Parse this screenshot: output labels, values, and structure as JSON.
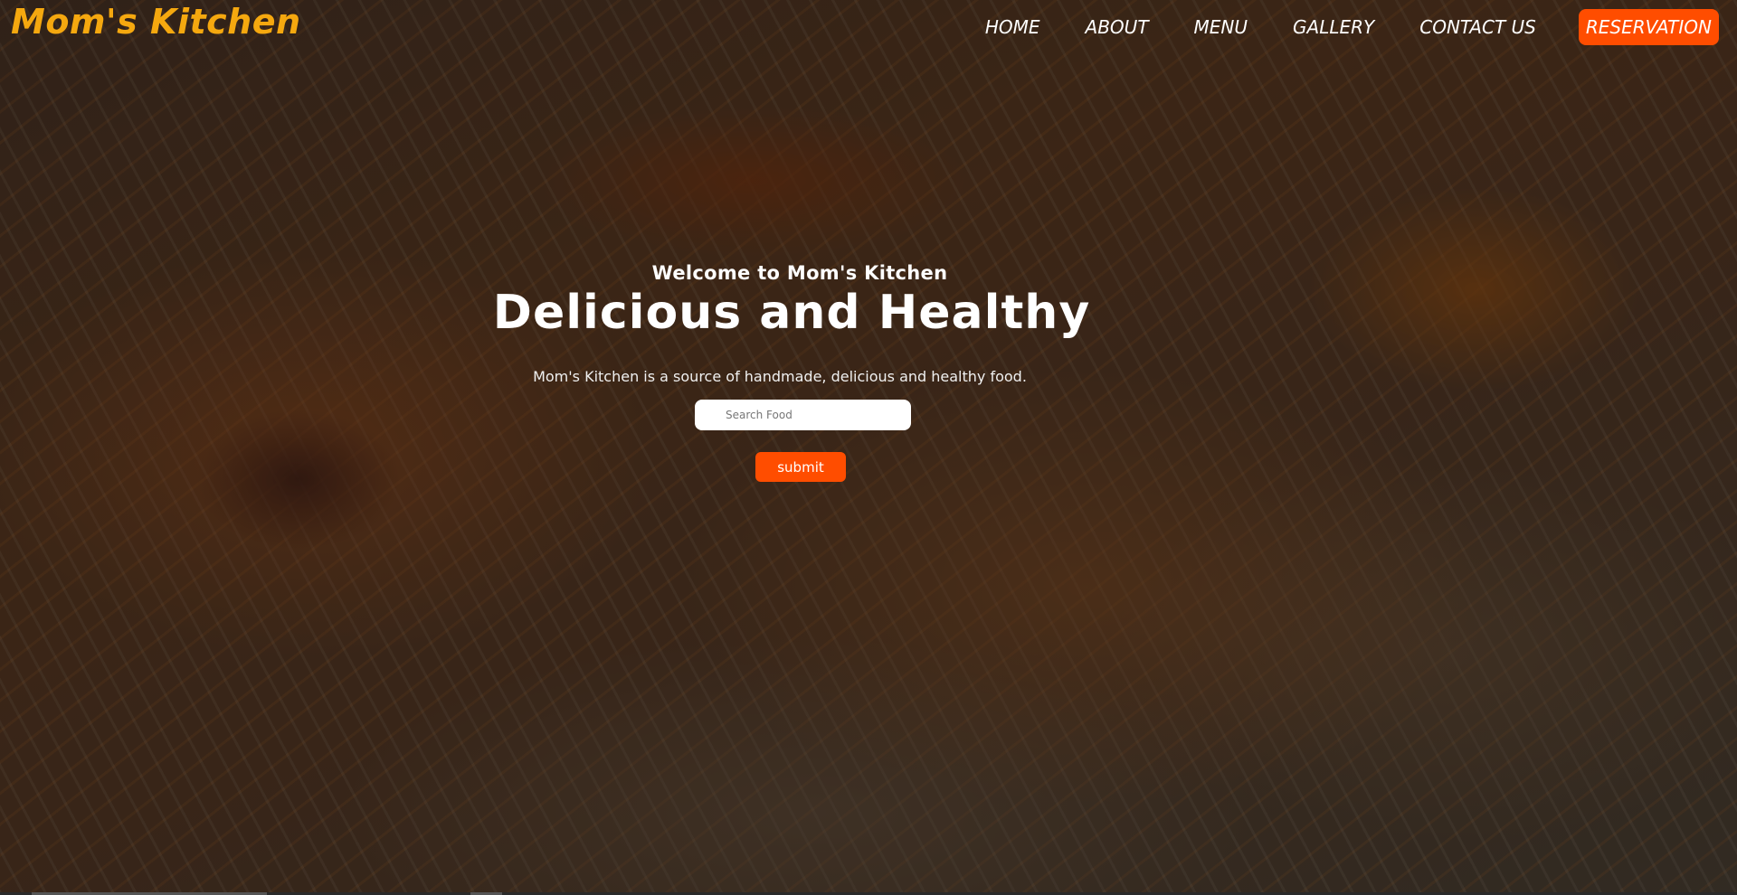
{
  "brand": {
    "logo_text": "Mom's Kitchen",
    "accent_color": "#f5a80f",
    "button_color": "#ff4d00"
  },
  "nav": {
    "items": [
      {
        "label": "HOME"
      },
      {
        "label": "ABOUT"
      },
      {
        "label": "MENU"
      },
      {
        "label": "GALLERY"
      },
      {
        "label": "CONTACT US"
      }
    ],
    "reservation_label": "RESERVATION"
  },
  "hero": {
    "welcome": "Welcome to Mom's Kitchen",
    "headline": "Delicious and Healthy",
    "subtext": "Mom's Kitchen is a source of handmade, delicious and healthy food.",
    "background": "biryani-rice-photo"
  },
  "search": {
    "placeholder": "Search Food",
    "value": "",
    "submit_label": "submit"
  }
}
